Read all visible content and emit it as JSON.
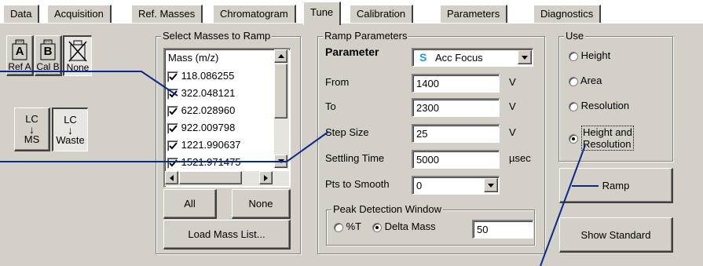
{
  "tabs": [
    {
      "label": "Data"
    },
    {
      "label": "Acquisition"
    },
    {
      "label": "Ref. Masses"
    },
    {
      "label": "Chromatogram"
    },
    {
      "label": "Tune"
    },
    {
      "label": "Calibration"
    },
    {
      "label": "Parameters"
    },
    {
      "label": "Diagnostics"
    }
  ],
  "active_tab": "Tune",
  "ref_buttons": [
    {
      "icon_letter": "A",
      "label": "Ref A"
    },
    {
      "icon_letter": "B",
      "label": "Cal B"
    },
    {
      "label": "None"
    }
  ],
  "lc_buttons": [
    {
      "top": "LC",
      "bottom": "MS"
    },
    {
      "top": "LC",
      "bottom": "Waste"
    }
  ],
  "select_masses": {
    "title": "Select Masses to Ramp",
    "header": "Mass (m/z)",
    "masses": [
      "118.086255",
      "322.048121",
      "622.028960",
      "922.009798",
      "1221.990637",
      "1521.971475"
    ],
    "all_label": "All",
    "none_label": "None",
    "load_label": "Load Mass List..."
  },
  "ramp": {
    "title": "Ramp Parameters",
    "parameter_label": "Parameter",
    "parameter_icon": "S",
    "parameter_value": "Acc Focus",
    "from_label": "From",
    "from_value": "1400",
    "from_unit": "V",
    "to_label": "To",
    "to_value": "2300",
    "to_unit": "V",
    "step_label": "Step Size",
    "step_value": "25",
    "step_unit": "V",
    "settling_label": "Settling Time",
    "settling_value": "5000",
    "settling_unit": "µsec",
    "smooth_label": "Pts to Smooth",
    "smooth_value": "0",
    "peak": {
      "title": "Peak Detection Window",
      "opt1": "%T",
      "opt2": "Delta Mass",
      "value": "50"
    }
  },
  "use": {
    "title": "Use",
    "options": [
      "Height",
      "Area",
      "Resolution",
      "Height and Resolution"
    ],
    "selected": "Height and Resolution",
    "option4_line1": "Height and",
    "option4_line2": "Resolution"
  },
  "ramp_button": "Ramp",
  "show_standard_button": "Show Standard",
  "colors": {
    "panel": "#d4d0c8",
    "accent_line": "#0a2a8a",
    "icon_s": "#1aa0d8"
  }
}
